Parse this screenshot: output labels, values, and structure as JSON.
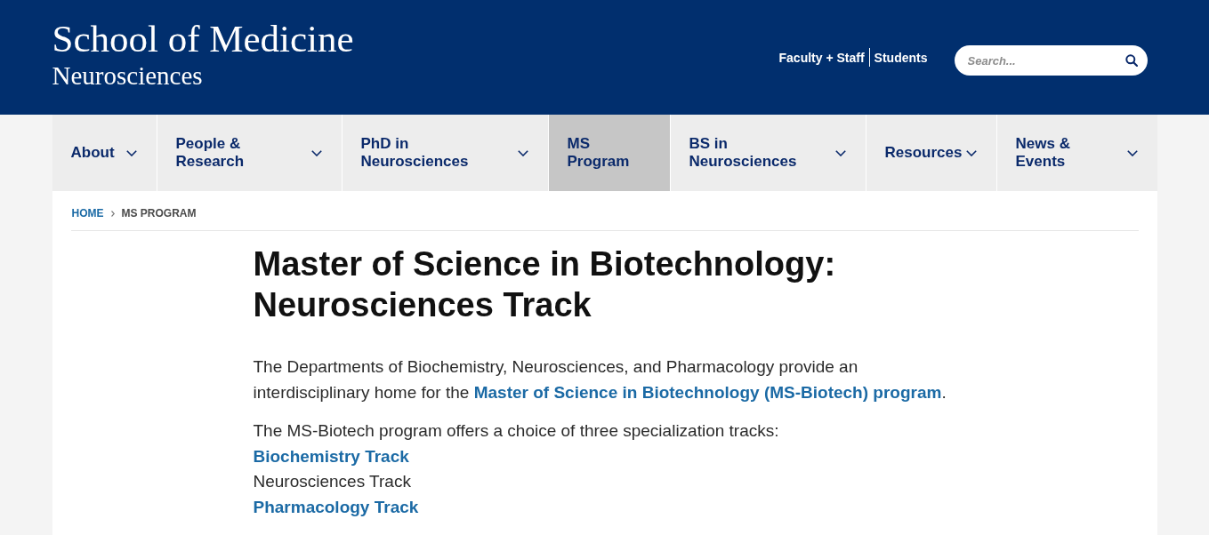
{
  "header": {
    "title": "School of Medicine",
    "subtitle": "Neurosciences",
    "utility_links": [
      {
        "label": "Faculty + Staff"
      },
      {
        "label": "Students"
      }
    ],
    "search": {
      "placeholder": "Search..."
    }
  },
  "nav": [
    {
      "label": "About",
      "selected": false,
      "has_menu": true
    },
    {
      "label": "People & Research",
      "selected": false,
      "has_menu": true
    },
    {
      "label": "PhD in Neurosciences",
      "selected": false,
      "has_menu": true
    },
    {
      "label": "MS Program",
      "selected": true,
      "has_menu": false
    },
    {
      "label": "BS in Neurosciences",
      "selected": false,
      "has_menu": true
    },
    {
      "label": "Resources",
      "selected": false,
      "has_menu": true
    },
    {
      "label": "News & Events",
      "selected": false,
      "has_menu": true
    }
  ],
  "breadcrumb": [
    {
      "label": "HOME",
      "kind": "link"
    },
    {
      "label": "MS PROGRAM",
      "kind": "current"
    }
  ],
  "content": {
    "heading": "Master of Science in Biotechnology: Neurosciences Track",
    "intro": {
      "text": "The Departments of Biochemistry, Neurosciences, and Pharmacology provide an interdisciplinary home for the ",
      "link": "Master of Science in Biotechnology (MS-Biotech) program",
      "after": "."
    },
    "tracks_intro": "The MS-Biotech program offers a choice of three specialization tracks:",
    "tracks": [
      {
        "label": "Biochemistry Track",
        "kind": "link"
      },
      {
        "label": "Neurosciences Track",
        "kind": "text"
      },
      {
        "label": "Pharmacology Track",
        "kind": "link"
      }
    ]
  }
}
